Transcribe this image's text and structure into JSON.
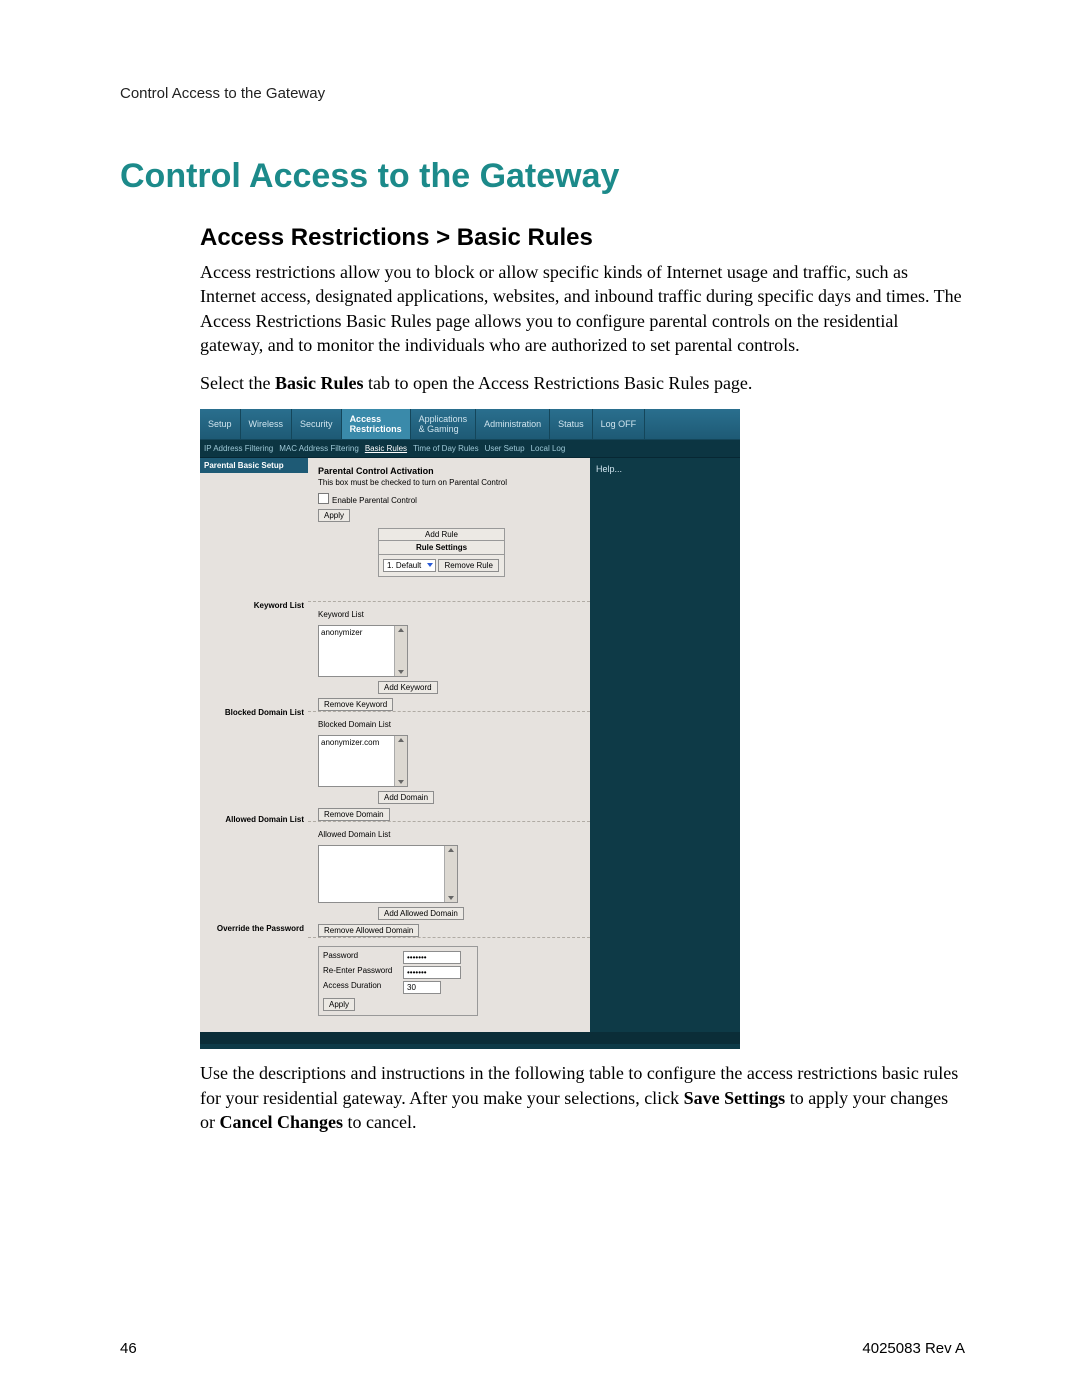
{
  "runhead": "Control Access to the Gateway",
  "title": "Control Access to the Gateway",
  "subtitle": "Access Restrictions > Basic Rules",
  "para1": "Access restrictions allow you to block or allow specific kinds of Internet usage and traffic, such as Internet access, designated applications, websites, and inbound traffic during specific days and times. The Access Restrictions Basic Rules page allows you to configure parental controls on the residential gateway, and to monitor the individuals who are authorized to set parental controls.",
  "para2_a": "Select the ",
  "para2_b": "Basic Rules",
  "para2_c": " tab to open the Access Restrictions Basic Rules page.",
  "para3_a": "Use the descriptions and instructions in the following table to configure the access restrictions basic rules for your residential gateway. After you make your selections, click ",
  "para3_b": "Save Settings",
  "para3_c": " to apply your changes or ",
  "para3_d": "Cancel Changes",
  "para3_e": " to cancel.",
  "page_number": "46",
  "doc_id": "4025083 Rev A",
  "ui": {
    "topnav": [
      "Setup",
      "Wireless",
      "Security",
      "Access\nRestrictions",
      "Applications\n& Gaming",
      "Administration",
      "Status",
      "Log OFF"
    ],
    "topnav_selected": 3,
    "subnav": [
      "IP Address Filtering",
      "MAC Address Filtering",
      "Basic Rules",
      "Time of Day Rules",
      "User Setup",
      "Local Log"
    ],
    "subnav_selected": 2,
    "help": "Help...",
    "left_strip": "Parental Basic Setup",
    "left_labels": {
      "keyword": "Keyword List",
      "blocked": "Blocked Domain List",
      "allowed": "Allowed Domain List",
      "override": "Override the Password"
    },
    "sec_pc": {
      "title": "Parental Control Activation",
      "note": "This box must be checked to turn on Parental Control",
      "checkbox": "Enable Parental Control",
      "apply": "Apply",
      "add_rule": "Add Rule",
      "rule_settings": "Rule Settings",
      "rule_select": "1. Default",
      "remove_rule": "Remove Rule"
    },
    "sec_kw": {
      "label": "Keyword List",
      "item": "anonymizer",
      "add": "Add Keyword",
      "remove": "Remove Keyword"
    },
    "sec_bd": {
      "label": "Blocked Domain List",
      "item": "anonymizer.com",
      "add": "Add Domain",
      "remove": "Remove Domain"
    },
    "sec_ad": {
      "label": "Allowed Domain List",
      "add": "Add Allowed Domain",
      "remove": "Remove Allowed Domain"
    },
    "sec_pw": {
      "l1": "Password",
      "l2": "Re-Enter Password",
      "l3": "Access Duration",
      "v1": "•••••••",
      "v2": "•••••••",
      "v3": "30",
      "apply": "Apply"
    }
  }
}
